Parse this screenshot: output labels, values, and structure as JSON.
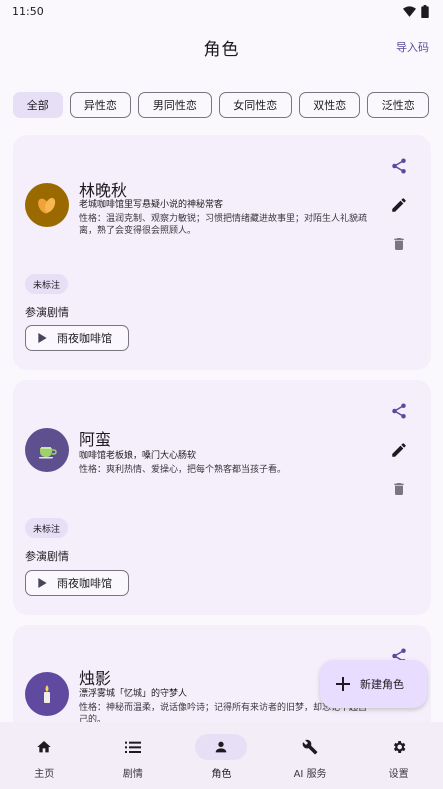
{
  "status_bar": {
    "time": "11:50"
  },
  "header": {
    "title": "角色",
    "import_label": "导入码"
  },
  "filters": [
    {
      "label": "全部",
      "selected": true
    },
    {
      "label": "异性恋",
      "selected": false
    },
    {
      "label": "男同性恋",
      "selected": false
    },
    {
      "label": "女同性恋",
      "selected": false
    },
    {
      "label": "双性恋",
      "selected": false
    },
    {
      "label": "泛性恋",
      "selected": false
    }
  ],
  "characters": [
    {
      "name": "林晚秋",
      "description": "老城咖啡馆里写悬疑小说的神秘常客",
      "trait": "性格：温润克制、观察力敏锐；习惯把情绪藏进故事里；对陌生人礼貌疏离，熟了会变得很会照顾人。",
      "avatar_icon": "leaf-icon",
      "avatar_color": "#9a6a00",
      "tag": "未标注",
      "story_label": "参演剧情",
      "story_button": "雨夜咖啡馆"
    },
    {
      "name": "阿蛮",
      "description": "咖啡馆老板娘，嗓门大心肠软",
      "trait": "性格：爽利热情、爱操心，把每个熟客都当孩子看。",
      "avatar_icon": "tea-cup-icon",
      "avatar_color": "#5e4f8f",
      "tag": "未标注",
      "story_label": "参演剧情",
      "story_button": "雨夜咖啡馆"
    },
    {
      "name": "烛影",
      "description": "漂浮雾城「忆城」的守梦人",
      "trait": "性格：神秘而温柔，说话像吟诗；记得所有来访者的旧梦，却忘记不起自己的。",
      "avatar_icon": "candle-icon",
      "avatar_color": "#5f4aa0"
    }
  ],
  "fab": {
    "label": "新建角色"
  },
  "nav": [
    {
      "label": "主页",
      "icon": "home-icon",
      "active": false
    },
    {
      "label": "剧情",
      "icon": "list-icon",
      "active": false
    },
    {
      "label": "角色",
      "icon": "person-icon",
      "active": true
    },
    {
      "label": "AI 服务",
      "icon": "wrench-icon",
      "active": false
    },
    {
      "label": "设置",
      "icon": "gear-icon",
      "active": false
    }
  ],
  "colors": {
    "accent": "#5b4b9e",
    "card_bg": "#f4effa",
    "chip_selected": "#e6dff6",
    "fab_bg": "#e9ddff",
    "icon_muted": "#7a7582"
  }
}
